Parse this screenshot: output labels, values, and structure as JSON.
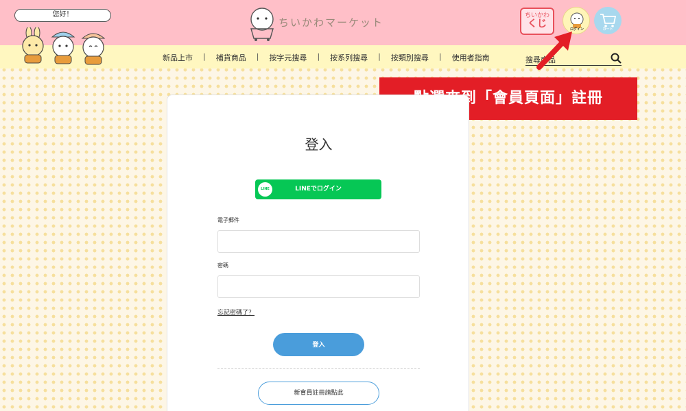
{
  "header": {
    "greeting": "您好！",
    "logo_text": "ちいかわマーケット",
    "kuji": {
      "line1": "ちいかわ",
      "line2": "くじ"
    },
    "login_label": "ログイン",
    "cart_label": "カート"
  },
  "nav": {
    "items": [
      "新品上市",
      "補貨商品",
      "按字元搜尋",
      "按系列搜尋",
      "按類別搜尋",
      "使用者指南"
    ],
    "search_placeholder": "搜尋商品"
  },
  "annotation": {
    "text": "點選來到「會員頁面」註冊",
    "color": "#e31e26"
  },
  "login": {
    "title": "登入",
    "line_logo": "LINE",
    "line_button": "LINEでログイン",
    "email_label": "電子郵件",
    "password_label": "密碼",
    "forgot": "忘記密碼了？",
    "submit": "登入",
    "register": "新會員註冊請點此"
  },
  "colors": {
    "header_pink": "#ffbfc8",
    "nav_yellow": "#fff7c0",
    "line_green": "#06c755",
    "button_blue": "#4a9ddb"
  }
}
